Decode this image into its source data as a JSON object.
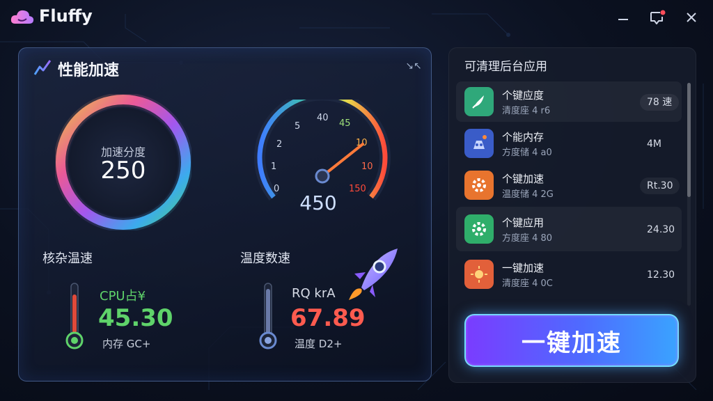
{
  "app": {
    "title": "Fluffy",
    "icons": {
      "logo": "cloud-logo-icon",
      "minimize": "minimize-icon",
      "message": "chat-notification-icon",
      "close": "close-icon"
    },
    "notification_dot_color": "#ff4d5a"
  },
  "main_panel": {
    "title": "性能加速",
    "icon": "trend-line-icon",
    "collapse_icon": "collapse-arrows-icon",
    "ring_gauge": {
      "label": "加速分度",
      "value": "250"
    },
    "speedometer": {
      "ticks": [
        "0",
        "1",
        "2",
        "5",
        "40",
        "45",
        "10",
        "10",
        "150"
      ],
      "value": "450"
    },
    "left_section": {
      "label": "核杂温速",
      "metric_name": "CPU占¥",
      "metric_value": "45.30",
      "metric_sub": "内存 GC+",
      "value_color": "#5fd36a"
    },
    "right_section": {
      "label": "温度数速",
      "metric_name": "RQ krA",
      "metric_value": "67.89",
      "metric_sub": "温度 D2+",
      "value_color": "#ff5b4f"
    }
  },
  "side_panel": {
    "title": "可清理后台应用",
    "apps": [
      {
        "name": "个键应度",
        "sub": "清度座 4 r6",
        "badge": "78 速",
        "icon": "rocket-app-icon",
        "color": "#2fa87a"
      },
      {
        "name": "个能内存",
        "sub": "方度储 4 a0",
        "badge": "4M",
        "icon": "robot-app-icon",
        "color": "#3a5cc8"
      },
      {
        "name": "个键加速",
        "sub": "温度储 4 2G",
        "badge": "Rt.30",
        "icon": "gear-app-icon",
        "color": "#e8742e"
      },
      {
        "name": "个键应用",
        "sub": "方度座 4 80",
        "badge": "24.30",
        "icon": "cog-app-icon",
        "color": "#2fae6a"
      },
      {
        "name": "一键加速",
        "sub": "清度座 4 0C",
        "badge": "12.30",
        "icon": "sun-app-icon",
        "color": "#e2603a"
      }
    ],
    "boost_button": "一键加速"
  }
}
